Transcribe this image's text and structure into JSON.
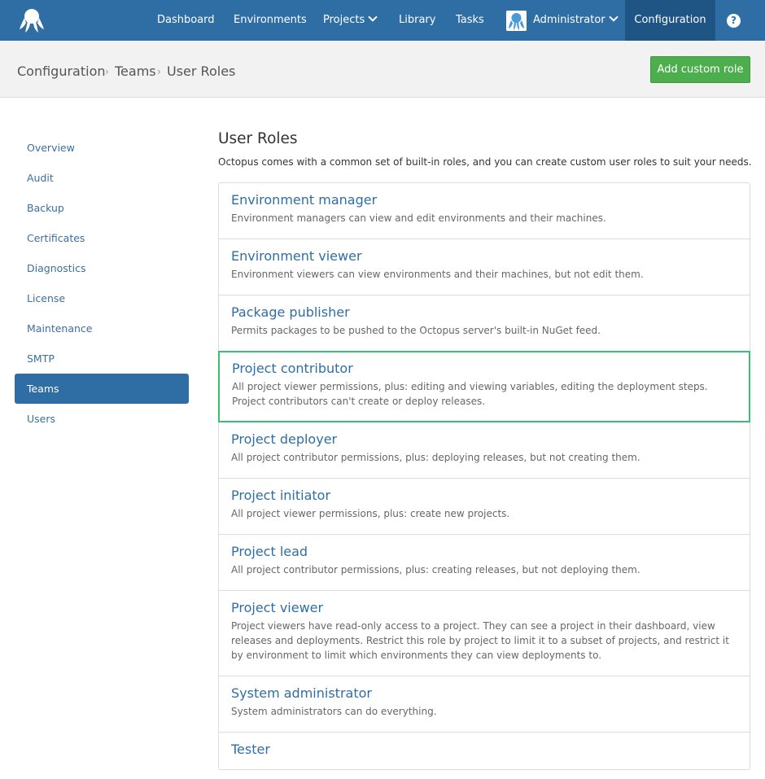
{
  "topnav": {
    "items": [
      "Dashboard",
      "Environments",
      "Projects",
      "Library",
      "Tasks",
      "Administrator",
      "Configuration"
    ],
    "help_label": "?"
  },
  "header": {
    "breadcrumbs": [
      "Configuration",
      "Teams",
      "User Roles"
    ],
    "add_button": "Add custom role"
  },
  "sidebar": {
    "items": [
      "Overview",
      "Audit",
      "Backup",
      "Certificates",
      "Diagnostics",
      "License",
      "Maintenance",
      "SMTP",
      "Teams",
      "Users"
    ],
    "active": "Teams"
  },
  "main": {
    "title": "User Roles",
    "description": "Octopus comes with a common set of built-in roles, and you can create custom user roles to suit your needs.",
    "roles": [
      {
        "name": "Environment manager",
        "desc": "Environment managers can view and edit environments and their machines."
      },
      {
        "name": "Environment viewer",
        "desc": "Environment viewers can view environments and their machines, but not edit them."
      },
      {
        "name": "Package publisher",
        "desc": "Permits packages to be pushed to the Octopus server's built-in NuGet feed."
      },
      {
        "name": "Project contributor",
        "desc": "All project viewer permissions, plus: editing and viewing variables, editing the deployment steps. Project contributors can't create or deploy releases."
      },
      {
        "name": "Project deployer",
        "desc": "All project contributor permissions, plus: deploying releases, but not creating them."
      },
      {
        "name": "Project initiator",
        "desc": "All project viewer permissions, plus: create new projects."
      },
      {
        "name": "Project lead",
        "desc": "All project contributor permissions, plus: creating releases, but not deploying them."
      },
      {
        "name": "Project viewer",
        "desc": "Project viewers have read-only access to a project. They can see a project in their dashboard, view releases and deployments. Restrict this role by project to limit it to a subset of projects, and restrict it by environment to limit which environments they can view deployments to."
      },
      {
        "name": "System administrator",
        "desc": "System administrators can do everything."
      },
      {
        "name": "Tester",
        "desc": ""
      }
    ]
  },
  "colors": {
    "nav_bg": "#2f6ea5",
    "nav_active": "#1e5584",
    "accent_green": "#4cae4c",
    "selected_border": "#3bbf74",
    "link_blue": "#2f6ea5"
  },
  "icons": [
    "octopus-logo-icon",
    "chevron-down-icon",
    "user-avatar-icon",
    "help-icon"
  ]
}
